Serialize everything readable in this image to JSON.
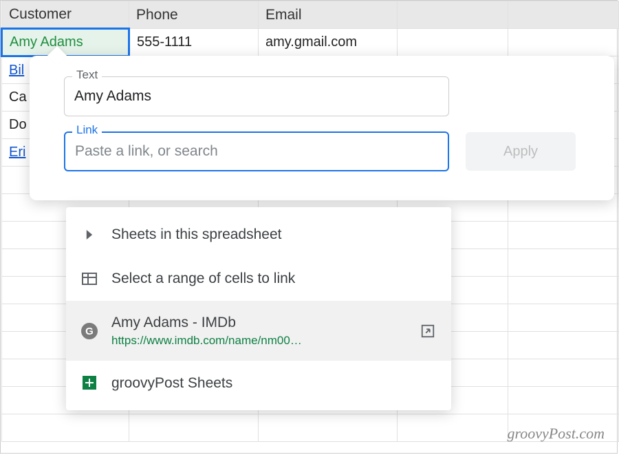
{
  "headers": {
    "col_a": "Customer",
    "col_b": "Phone",
    "col_c": "Email"
  },
  "rows": [
    {
      "a": "Amy Adams",
      "b": "555-1111",
      "c": "amy.gmail.com"
    },
    {
      "a": "Bil",
      "b": "",
      "c": ""
    },
    {
      "a": "Ca",
      "b": "",
      "c": ""
    },
    {
      "a": "Do",
      "b": "",
      "c": ""
    },
    {
      "a": "Eri",
      "b": "",
      "c": ""
    }
  ],
  "linkEditor": {
    "textLabel": "Text",
    "textValue": "Amy Adams",
    "linkLabel": "Link",
    "linkPlaceholder": "Paste a link, or search",
    "applyLabel": "Apply"
  },
  "suggestions": {
    "sheetsOption": "Sheets in this spreadsheet",
    "rangeOption": "Select a range of cells to link",
    "searchResult": {
      "title": "Amy Adams - IMDb",
      "url": "https://www.imdb.com/name/nm00…"
    },
    "docResult": "groovyPost Sheets"
  },
  "watermark": "groovyPost.com"
}
